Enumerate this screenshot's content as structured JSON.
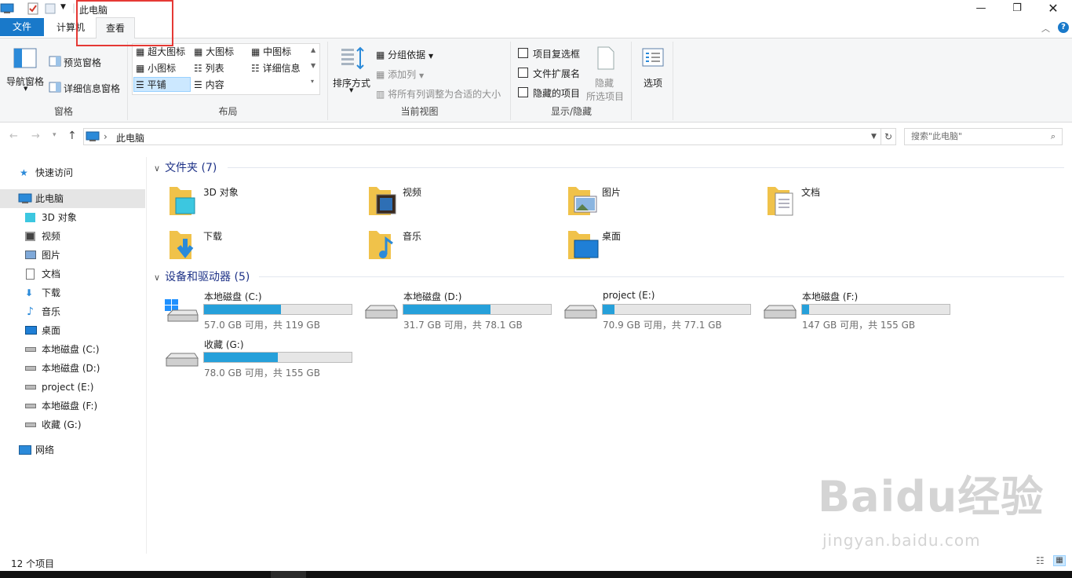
{
  "window": {
    "title": "此电脑"
  },
  "tabs": {
    "file": "文件",
    "computer": "计算机",
    "view": "查看"
  },
  "ribbon": {
    "panes": {
      "nav_pane": "导航窗格",
      "preview_pane": "预览窗格",
      "details_pane": "详细信息窗格",
      "label": "窗格"
    },
    "layout": {
      "extra_large": "超大图标",
      "large": "大图标",
      "medium": "中图标",
      "small": "小图标",
      "list": "列表",
      "details": "详细信息",
      "tiles": "平铺",
      "content": "内容",
      "label": "布局"
    },
    "current_view": {
      "sort_by": "排序方式",
      "group_by": "分组依据",
      "add_columns": "添加列",
      "size_columns": "将所有列调整为合适的大小",
      "label": "当前视图"
    },
    "show_hide": {
      "item_checkboxes": "项目复选框",
      "file_extensions": "文件扩展名",
      "hidden_items": "隐藏的项目",
      "hide_selected_1": "隐藏",
      "hide_selected_2": "所选项目",
      "label": "显示/隐藏"
    },
    "options": "选项"
  },
  "address": {
    "path": "此电脑",
    "search_placeholder": "搜索\"此电脑\""
  },
  "nav_pane": {
    "quick_access": "快速访问",
    "this_pc": "此电脑",
    "items": [
      "3D 对象",
      "视频",
      "图片",
      "文档",
      "下载",
      "音乐",
      "桌面",
      "本地磁盘 (C:)",
      "本地磁盘 (D:)",
      "project (E:)",
      "本地磁盘 (F:)",
      "收藏 (G:)"
    ],
    "network": "网络"
  },
  "folders": {
    "header": "文件夹 (7)",
    "items": [
      "3D 对象",
      "视频",
      "图片",
      "文档",
      "下载",
      "音乐",
      "桌面"
    ]
  },
  "drives": {
    "header": "设备和驱动器 (5)",
    "items": [
      {
        "name": "本地磁盘 (C:)",
        "free": "57.0 GB 可用，共 119 GB",
        "used_fraction": 0.52
      },
      {
        "name": "本地磁盘 (D:)",
        "free": "31.7 GB 可用，共 78.1 GB",
        "used_fraction": 0.59
      },
      {
        "name": "project (E:)",
        "free": "70.9 GB 可用，共 77.1 GB",
        "used_fraction": 0.08
      },
      {
        "name": "本地磁盘 (F:)",
        "free": "147 GB 可用，共 155 GB",
        "used_fraction": 0.05
      },
      {
        "name": "收藏 (G:)",
        "free": "78.0 GB 可用，共 155 GB",
        "used_fraction": 0.5
      }
    ]
  },
  "status": {
    "count": "12 个项目"
  },
  "watermark": {
    "brand": "Baidu经验",
    "url": "jingyan.baidu.com"
  },
  "colors": {
    "accent": "#1979ca",
    "drive_fill": "#26a0da",
    "folder": "#f0c24a",
    "highlight_box": "#e53935"
  }
}
